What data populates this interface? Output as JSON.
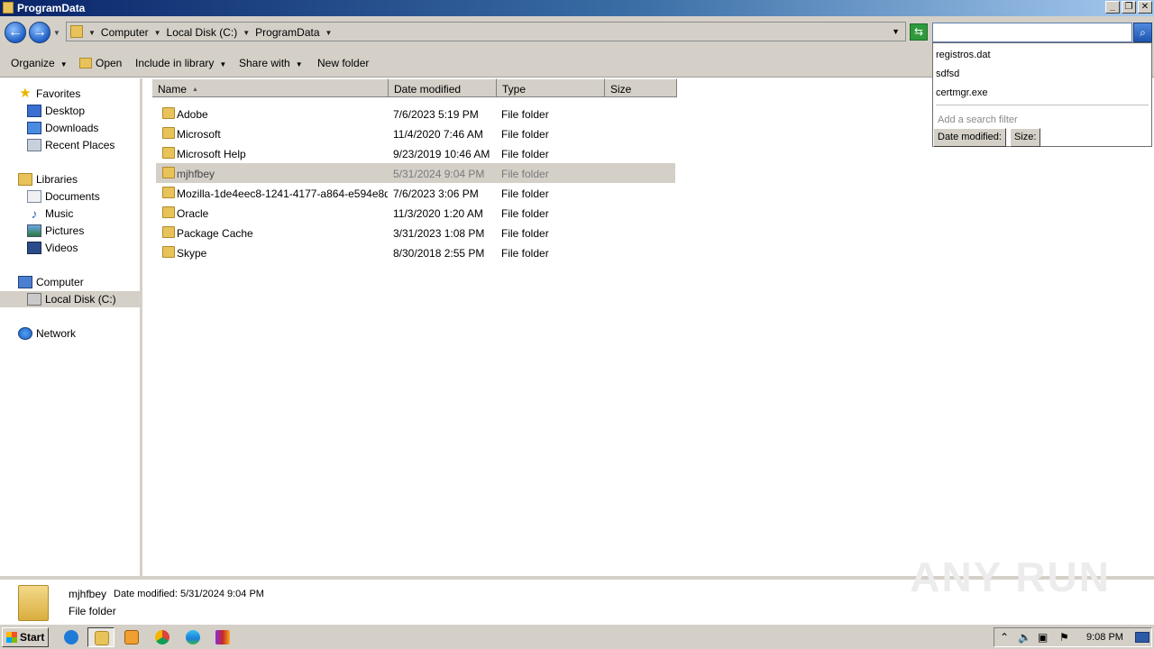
{
  "window": {
    "title": "ProgramData",
    "minimize": "_",
    "restore": "❐",
    "close": "✕"
  },
  "address": {
    "breadcrumbs": [
      "Computer",
      "Local Disk (C:)",
      "ProgramData"
    ],
    "search_value": "",
    "nav_back": "←",
    "nav_forward": "→",
    "refresh": "⇆",
    "search_button": "⌕"
  },
  "toolbar": {
    "organize": "Organize",
    "open": "Open",
    "include_in_library": "Include in library",
    "share_with": "Share with",
    "new_folder": "New folder"
  },
  "nav": {
    "favorites": "Favorites",
    "desktop": "Desktop",
    "downloads": "Downloads",
    "recent_places": "Recent Places",
    "libraries": "Libraries",
    "documents": "Documents",
    "music": "Music",
    "pictures": "Pictures",
    "videos": "Videos",
    "computer": "Computer",
    "local_disk": "Local Disk (C:)",
    "network": "Network"
  },
  "columns": {
    "name": "Name",
    "date_modified": "Date modified",
    "type": "Type",
    "size": "Size"
  },
  "files": [
    {
      "name": "Adobe",
      "date": "7/6/2023 5:19 PM",
      "type": "File folder"
    },
    {
      "name": "Microsoft",
      "date": "11/4/2020 7:46 AM",
      "type": "File folder"
    },
    {
      "name": "Microsoft Help",
      "date": "9/23/2019 10:46 AM",
      "type": "File folder"
    },
    {
      "name": "mjhfbey",
      "date": "5/31/2024 9:04 PM",
      "type": "File folder",
      "selected": true
    },
    {
      "name": "Mozilla-1de4eec8-1241-4177-a864-e594e8d...",
      "date": "7/6/2023 3:06 PM",
      "type": "File folder"
    },
    {
      "name": "Oracle",
      "date": "11/3/2020 1:20 AM",
      "type": "File folder"
    },
    {
      "name": "Package Cache",
      "date": "3/31/2023 1:08 PM",
      "type": "File folder"
    },
    {
      "name": "Skype",
      "date": "8/30/2018 2:55 PM",
      "type": "File folder"
    }
  ],
  "search_suggestions": {
    "items": [
      "registros.dat",
      "sdfsd",
      "certmgr.exe"
    ],
    "hint": "Add a search filter",
    "filter_date": "Date modified:",
    "filter_size": "Size:"
  },
  "details": {
    "name": "mjhfbey",
    "date_label": "Date modified:",
    "date_value": "5/31/2024 9:04 PM",
    "type": "File folder"
  },
  "watermark": "ANY RUN",
  "taskbar": {
    "start": "Start",
    "clock": "9:08 PM"
  },
  "colors": {
    "selection": "#d4d0c8",
    "title_start": "#0a246a",
    "folder": "#e8c35a"
  }
}
